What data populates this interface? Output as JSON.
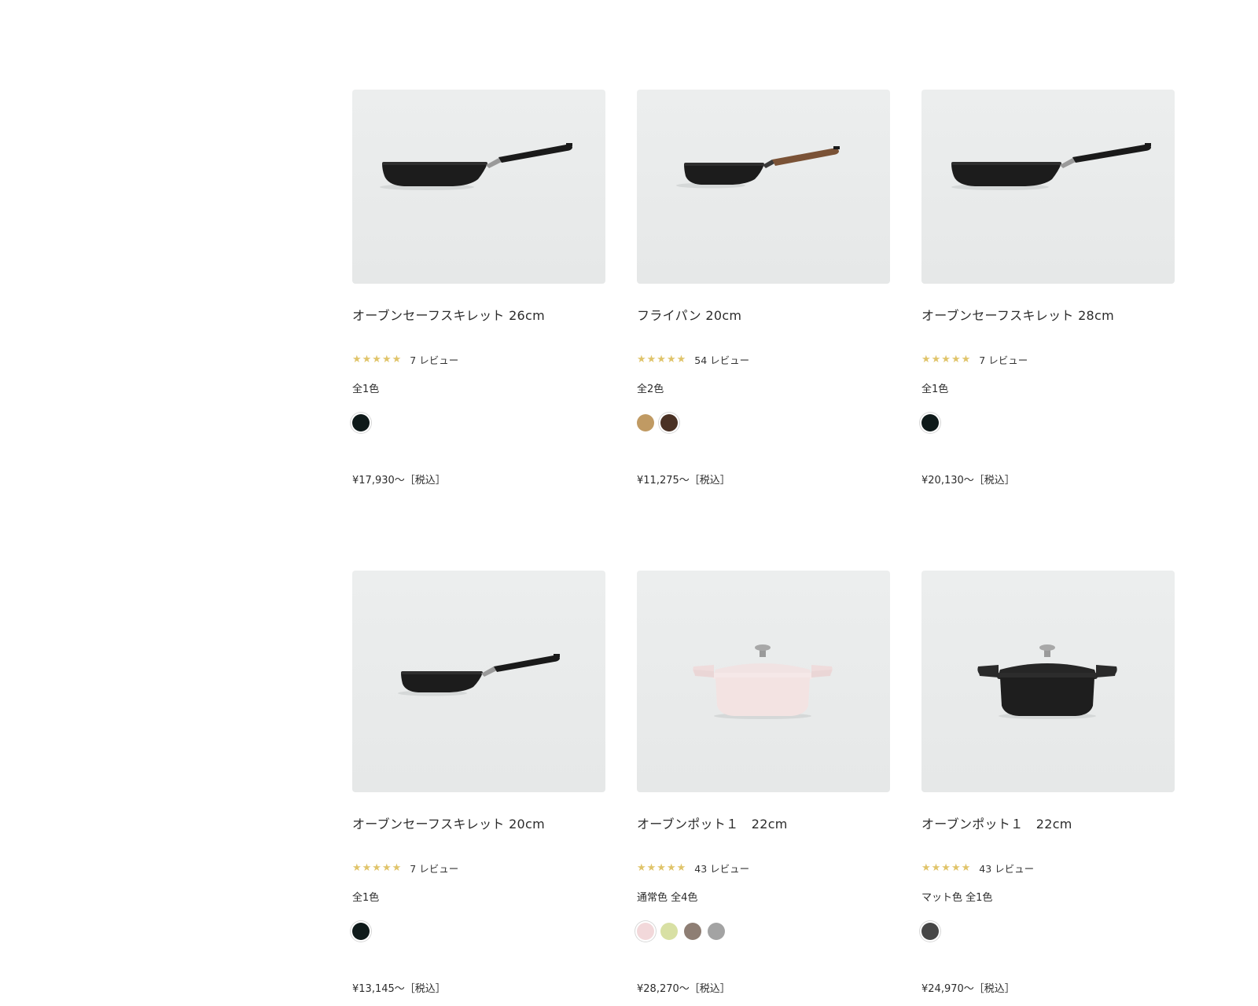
{
  "products": [
    {
      "name": "オーブンセーフスキレット 26cm",
      "image": "skillet-black-icon",
      "stars": "★★★★★",
      "reviews": "7 レビュー",
      "colors_label": "全1色",
      "colors": [
        "#0f1a1a"
      ],
      "price": "¥17,930〜［税込］"
    },
    {
      "name": "フライパン 20cm",
      "image": "frypan-wood-handle-icon",
      "stars": "★★★★★",
      "reviews": "54 レビュー",
      "colors_label": "全2色",
      "colors": [
        "#c09a63",
        "#4a3124"
      ],
      "price": "¥11,275〜［税込］"
    },
    {
      "name": "オーブンセーフスキレット 28cm",
      "image": "skillet-black-icon",
      "stars": "★★★★★",
      "reviews": "7 レビュー",
      "colors_label": "全1色",
      "colors": [
        "#0f1a1a"
      ],
      "price": "¥20,130〜［税込］"
    },
    {
      "name": "オーブンセーフスキレット 20cm",
      "image": "skillet-black-small-icon",
      "stars": "★★★★★",
      "reviews": "7 レビュー",
      "colors_label": "全1色",
      "colors": [
        "#0f1a1a"
      ],
      "price": "¥13,145〜［税込］"
    },
    {
      "name": "オーブンポット１　22cm",
      "image": "pot-pink-icon",
      "stars": "★★★★★",
      "reviews": "43 レビュー",
      "colors_label": "通常色  全4色",
      "colors": [
        "#f2d8da",
        "#d8e0a4",
        "#8e7e74",
        "#a3a3a3"
      ],
      "price": "¥28,270〜［税込］"
    },
    {
      "name": "オーブンポット１　22cm",
      "image": "pot-black-icon",
      "stars": "★★★★★",
      "reviews": "43 レビュー",
      "colors_label": "マット色  全1色",
      "colors": [
        "#464646"
      ],
      "price": "¥24,970〜［税込］"
    }
  ]
}
